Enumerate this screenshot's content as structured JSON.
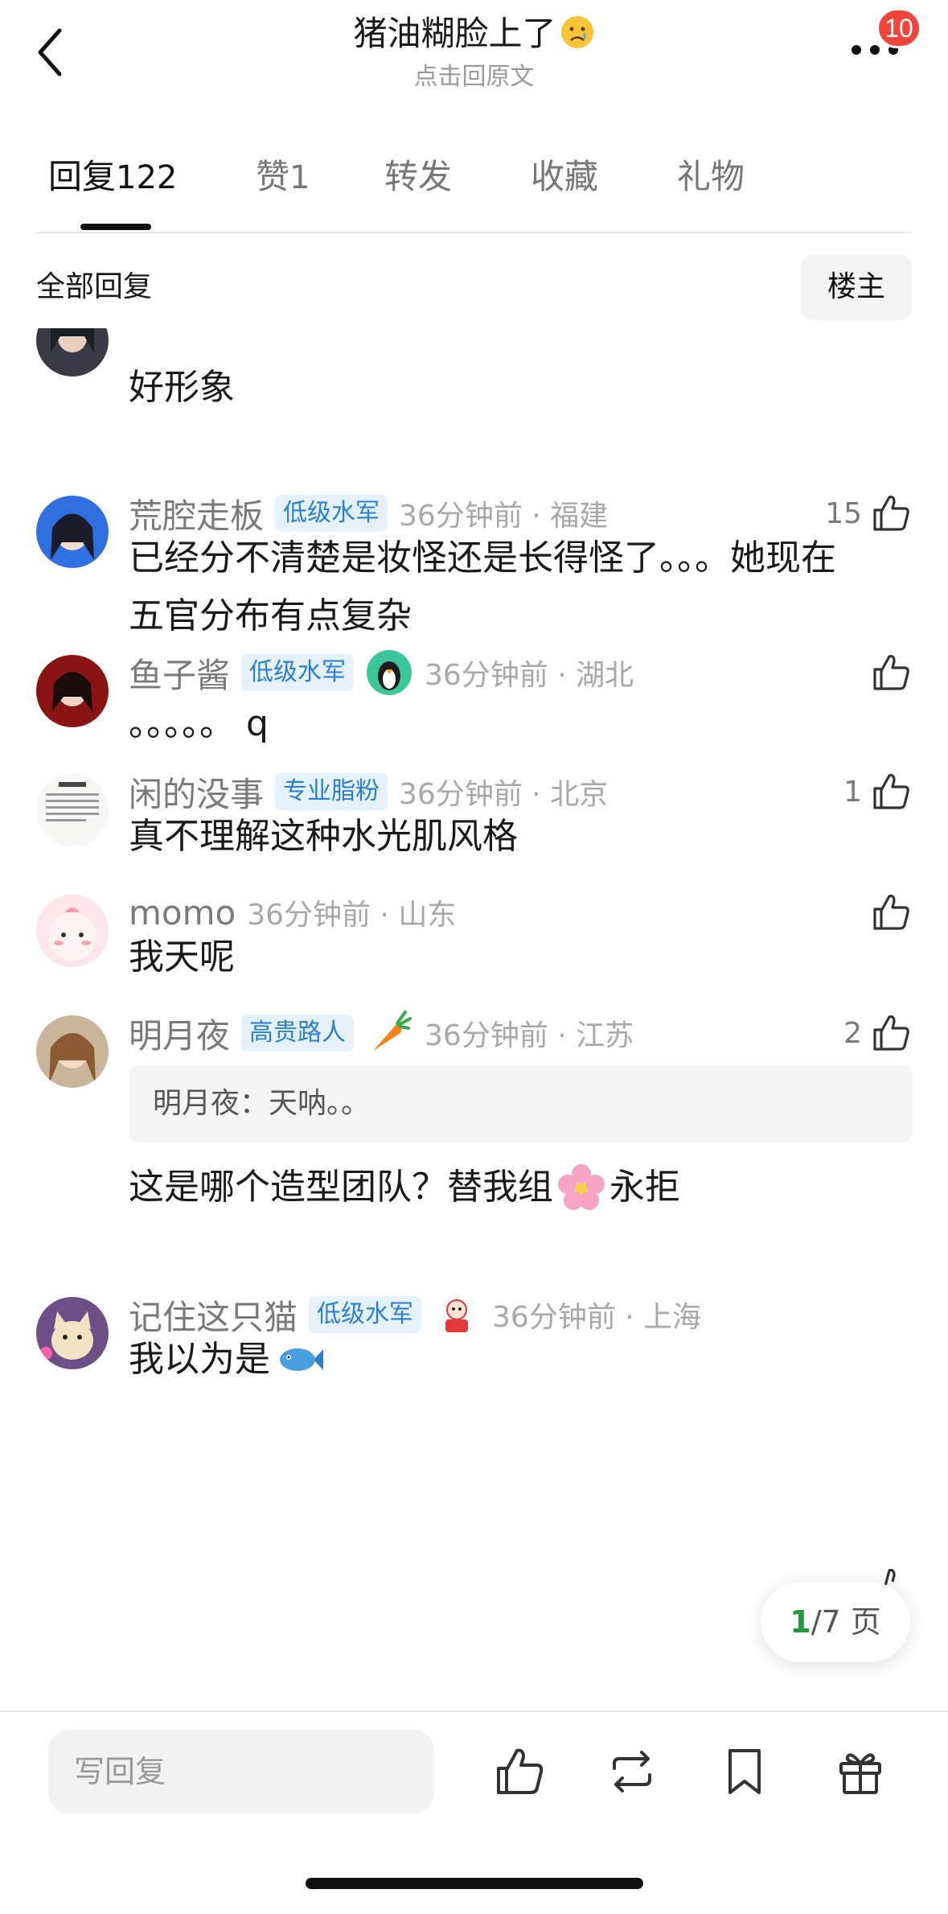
{
  "header": {
    "title": "猪油糊脸上了",
    "title_emoji": "crying-face",
    "subtitle": "点击回原文",
    "badge": "10"
  },
  "tabs": [
    {
      "label": "回复",
      "count": "122",
      "active": true
    },
    {
      "label": "赞",
      "count": "1",
      "active": false
    },
    {
      "label": "转发",
      "count": "",
      "active": false
    },
    {
      "label": "收藏",
      "count": "",
      "active": false
    },
    {
      "label": "礼物",
      "count": "",
      "active": false
    }
  ],
  "filter": {
    "title": "全部回复",
    "owner_button": "楼主"
  },
  "comments": [
    {
      "user": "",
      "level": "",
      "time": "",
      "likes": "",
      "text": "好形象",
      "partial": true
    },
    {
      "user": "荒腔走板",
      "level": "低级水军",
      "time": "36分钟前 · 福建",
      "likes": "15",
      "text_lines": [
        "已经分不清楚是妆怪还是长得怪了。。。她现在",
        "五官分布有点复杂"
      ]
    },
    {
      "user": "鱼子酱",
      "level": "低级水军",
      "medal": "penguin-medal",
      "time": "36分钟前 · 湖北",
      "likes": "",
      "text": "。。。。。 q"
    },
    {
      "user": "闲的没事",
      "level": "专业脂粉",
      "time": "36分钟前 · 北京",
      "likes": "1",
      "text": "真不理解这种水光肌风格"
    },
    {
      "user": "momo",
      "level": "",
      "time": "36分钟前 · 山东",
      "likes": "",
      "text": "我天呢"
    },
    {
      "user": "明月夜",
      "level": "高贵路人",
      "medal": "carrot-medal",
      "time": "36分钟前 · 江苏",
      "likes": "2",
      "quote": "明月夜：天呐。。",
      "text_pre": "这是哪个造型团队？替我组",
      "text_emoji": "flower",
      "text_post": "永拒"
    },
    {
      "user": "记住这只猫",
      "level": "低级水军",
      "medal": "mascot-medal",
      "time": "36分钟前 · 上海",
      "likes": "",
      "text_pre": "我以为是",
      "text_emoji": "fish"
    }
  ],
  "pager": {
    "current": "1",
    "total": "/7 页"
  },
  "bottom_bar": {
    "reply_placeholder": "写回复"
  },
  "colors": {
    "accent_blue": "#2a7fd4",
    "badge_red": "#f0443c",
    "pager_green": "#1f9b3a"
  }
}
